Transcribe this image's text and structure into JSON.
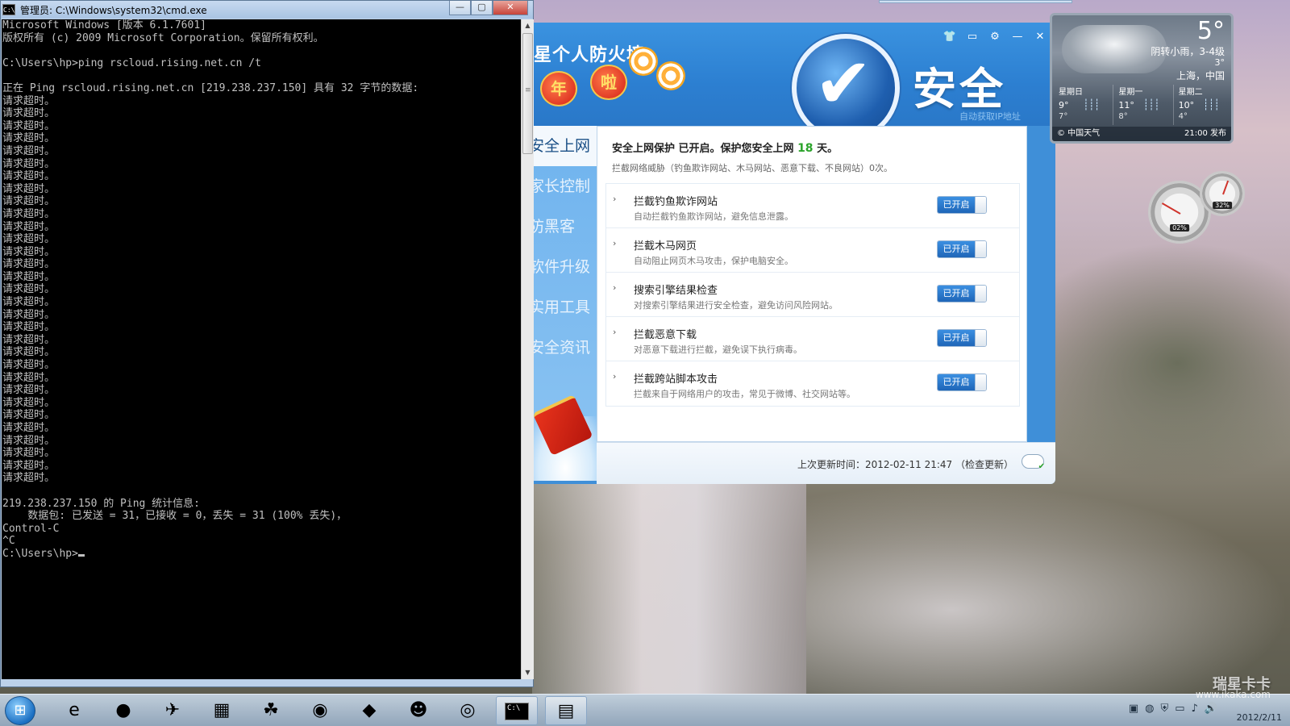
{
  "cmd": {
    "title": "管理员: C:\\Windows\\system32\\cmd.exe",
    "icon_text": "C:\\",
    "minimize_glyph": "—",
    "restore_glyph": "▢",
    "close_glyph": "✕",
    "lines": [
      "Microsoft Windows [版本 6.1.7601]",
      "版权所有 (c) 2009 Microsoft Corporation。保留所有权利。",
      "",
      "C:\\Users\\hp>ping rscloud.rising.net.cn /t",
      "",
      "正在 Ping rscloud.rising.net.cn [219.238.237.150] 具有 32 字节的数据:",
      "请求超时。",
      "请求超时。",
      "请求超时。",
      "请求超时。",
      "请求超时。",
      "请求超时。",
      "请求超时。",
      "请求超时。",
      "请求超时。",
      "请求超时。",
      "请求超时。",
      "请求超时。",
      "请求超时。",
      "请求超时。",
      "请求超时。",
      "请求超时。",
      "请求超时。",
      "请求超时。",
      "请求超时。",
      "请求超时。",
      "请求超时。",
      "请求超时。",
      "请求超时。",
      "请求超时。",
      "请求超时。",
      "请求超时。",
      "请求超时。",
      "请求超时。",
      "请求超时。",
      "请求超时。",
      "请求超时。",
      "",
      "219.238.237.150 的 Ping 统计信息:",
      "    数据包: 已发送 = 31，已接收 = 0，丢失 = 31 (100% 丢失)，",
      "Control-C",
      "^C"
    ],
    "prompt": "C:\\Users\\hp>",
    "scroll_up": "▲",
    "scroll_down": "▼"
  },
  "firewall": {
    "brand": "星个人防火墙",
    "lantern_1": "年",
    "lantern_2": "啦",
    "status_text": "安全",
    "auto_ip": "自动获取IP地址",
    "controls": [
      "👕",
      "▭",
      "⚙",
      "—",
      "✕"
    ],
    "nav": [
      "安全上网",
      "家长控制",
      "防黑客",
      "软件升级",
      "实用工具",
      "安全资讯"
    ],
    "main_title_prefix": "安全上网保护 已开启。保护您安全上网 ",
    "main_title_days": "18",
    "main_title_suffix": " 天。",
    "main_subtitle": "拦截网络威胁（钓鱼欺诈网站、木马网站、恶意下载、不良网站）0次。",
    "features": [
      {
        "title": "拦截钓鱼欺诈网站",
        "desc": "自动拦截钓鱼欺诈网站，避免信息泄露。",
        "toggle": "已开启"
      },
      {
        "title": "拦截木马网页",
        "desc": "自动阻止网页木马攻击，保护电脑安全。",
        "toggle": "已开启"
      },
      {
        "title": "搜索引擎结果检查",
        "desc": "对搜索引擎结果进行安全检查，避免访问风险网站。",
        "toggle": "已开启"
      },
      {
        "title": "拦截恶意下载",
        "desc": "对恶意下载进行拦截，避免误下执行病毒。",
        "toggle": "已开启"
      },
      {
        "title": "拦截跨站脚本攻击",
        "desc": "拦截来自于网络用户的攻击，常见于微博、社交网站等。",
        "toggle": "已开启"
      }
    ],
    "footer_update": "上次更新时间：2012-02-11 21:47",
    "footer_check": "（检查更新）"
  },
  "weather": {
    "temp": "5°",
    "condition": "阴转小雨，3-4级",
    "low": "3°",
    "city": "上海，中国",
    "days": [
      {
        "name": "星期日",
        "hi": "9°",
        "lo": "7°"
      },
      {
        "name": "星期一",
        "hi": "11°",
        "lo": "8°"
      },
      {
        "name": "星期二",
        "hi": "10°",
        "lo": "4°"
      }
    ],
    "source": "© 中国天气",
    "published": "21:00 发布"
  },
  "meters": {
    "cpu": "02%",
    "memory": "32%"
  },
  "taskbar": {
    "start_glyph": "⊞",
    "items": [
      {
        "name": "ie-icon",
        "glyph": "e",
        "active": false
      },
      {
        "name": "qq-bubble-icon",
        "glyph": "●",
        "active": false
      },
      {
        "name": "bird-app-icon",
        "glyph": "✈",
        "active": false
      },
      {
        "name": "calculator-icon",
        "glyph": "▦",
        "active": false
      },
      {
        "name": "network-people-icon",
        "glyph": "☘",
        "active": false
      },
      {
        "name": "download-globe-icon",
        "glyph": "◉",
        "active": false
      },
      {
        "name": "security-shield-icon",
        "glyph": "◆",
        "active": false
      },
      {
        "name": "qq-penguin-icon",
        "glyph": "☻",
        "active": false
      },
      {
        "name": "media-player-icon",
        "glyph": "◎",
        "active": false
      },
      {
        "name": "cmd-task-icon",
        "glyph": "C:\\",
        "active": true
      },
      {
        "name": "firewall-task-icon",
        "glyph": "▤",
        "active": true
      }
    ],
    "tray": [
      "▣",
      "◍",
      "⛨",
      "▭",
      "♪",
      "🔊"
    ],
    "date": "2012/2/11",
    "watermark": "瑞星卡卡",
    "watermark_url": "www.ikaka.com"
  }
}
